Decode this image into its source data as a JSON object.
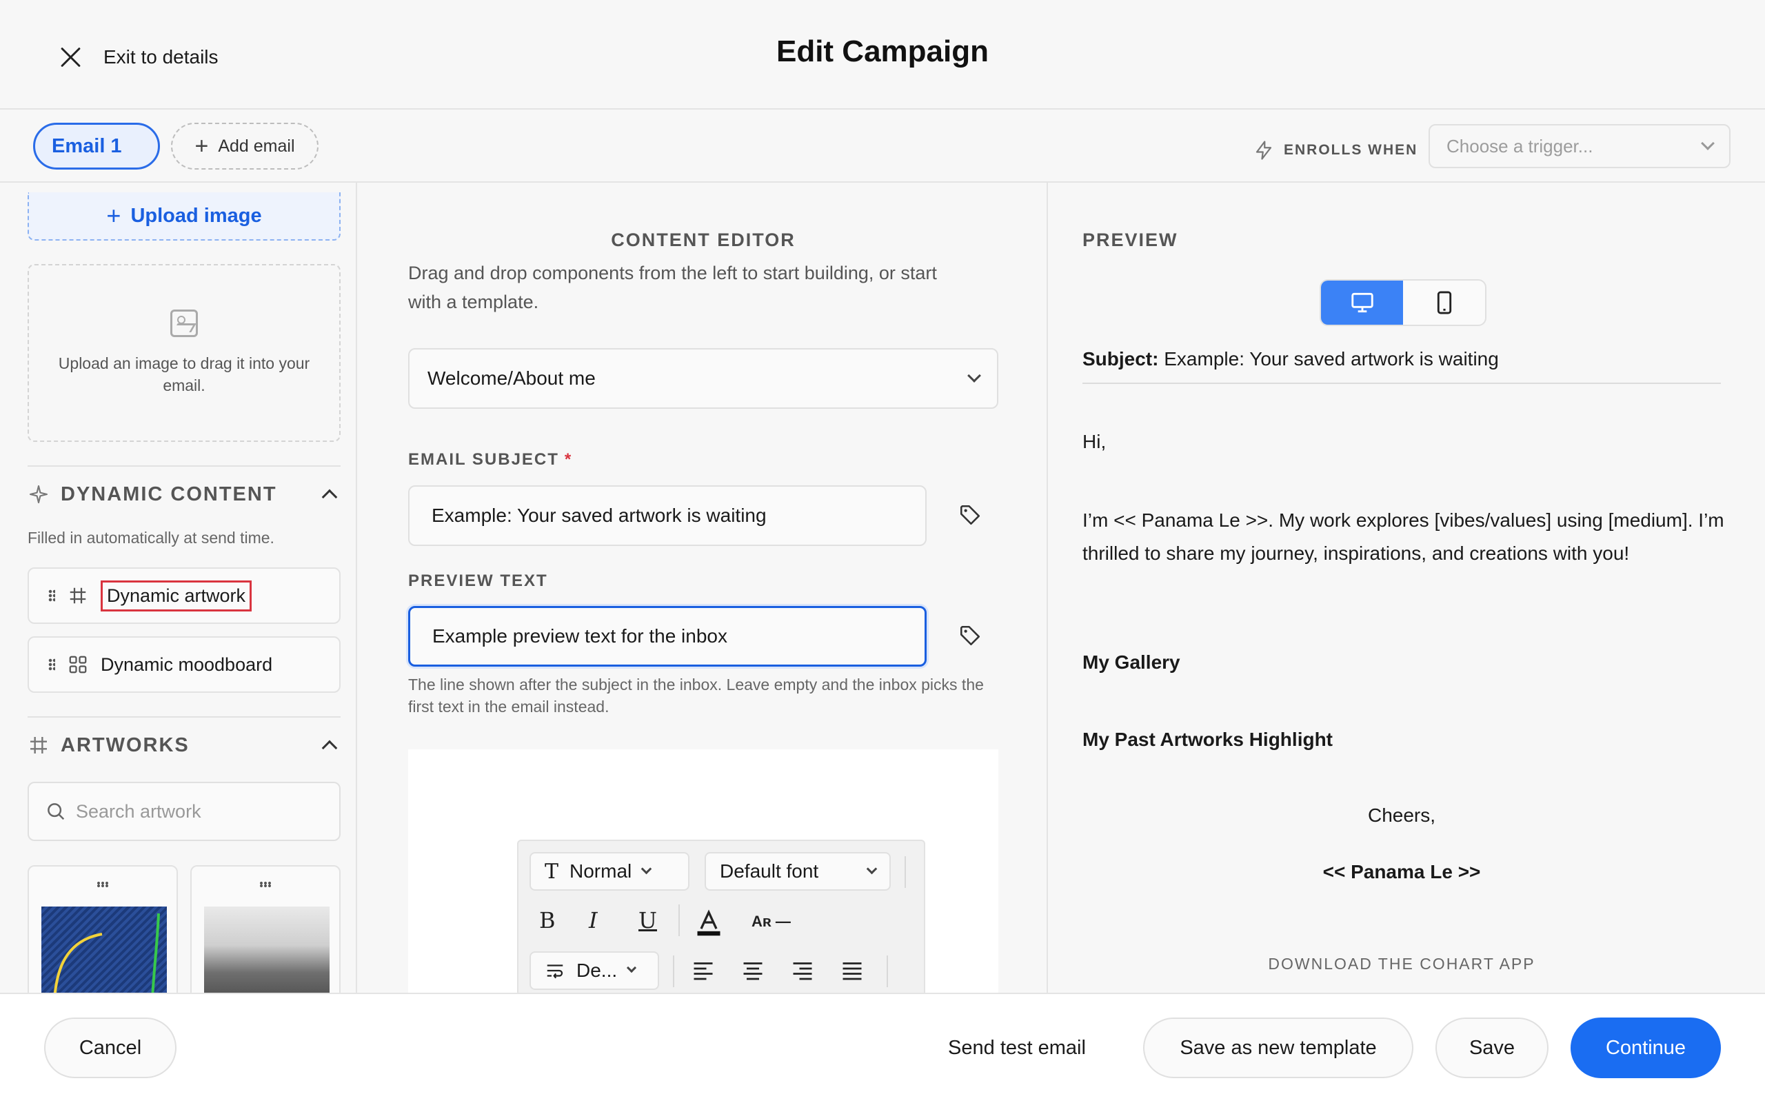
{
  "header": {
    "exit_label": "Exit to details",
    "title": "Edit Campaign"
  },
  "tabs": {
    "email_tab": "Email 1",
    "add_email": "Add email",
    "enrolls_when": "ENROLLS WHEN",
    "trigger_placeholder": "Choose a trigger..."
  },
  "left": {
    "upload_button": "Upload image",
    "dropzone_text": "Upload an image to drag it into your email.",
    "dynamic_title": "DYNAMIC CONTENT",
    "dynamic_note": "Filled in automatically at send time.",
    "dynamic_items": [
      "Dynamic artwork",
      "Dynamic moodboard"
    ],
    "artworks_title": "ARTWORKS",
    "search_placeholder": "Search artwork"
  },
  "center": {
    "title": "CONTENT EDITOR",
    "description": "Drag and drop components from the left to start building, or start with a template.",
    "template_value": "Welcome/About me",
    "subject_label": "EMAIL SUBJECT",
    "subject_required": "*",
    "subject_value": "Example: Your saved artwork is waiting",
    "preview_label": "PREVIEW TEXT",
    "preview_value": "Example preview text for the inbox",
    "preview_hint": "The line shown after the subject in the inbox. Leave empty and the inbox picks the first text in the email instead.",
    "toolbar": {
      "style": "Normal",
      "font": "Default font",
      "bold": "B",
      "italic": "I",
      "underline": "U",
      "font_size_glyph": "Aʀ —",
      "line_height": "De..."
    }
  },
  "preview": {
    "title": "PREVIEW",
    "subject_label": "Subject:",
    "subject_value": "Example: Your saved artwork is waiting",
    "greeting": "Hi,",
    "body": "I’m << Panama Le >>. My work explores [vibes/values] using [medium]. I’m thrilled to share my journey, inspirations, and creations with you!",
    "gallery_heading": "My Gallery",
    "past_heading": "My Past Artworks Highlight",
    "signoff": "Cheers,",
    "signature": "<< Panama Le >>",
    "download": "DOWNLOAD THE COHART APP"
  },
  "footer": {
    "cancel": "Cancel",
    "send_test": "Send test email",
    "save_template": "Save as new template",
    "save": "Save",
    "continue": "Continue"
  },
  "colors": {
    "accent": "#1a6df2",
    "highlight_box": "#d9343f"
  }
}
